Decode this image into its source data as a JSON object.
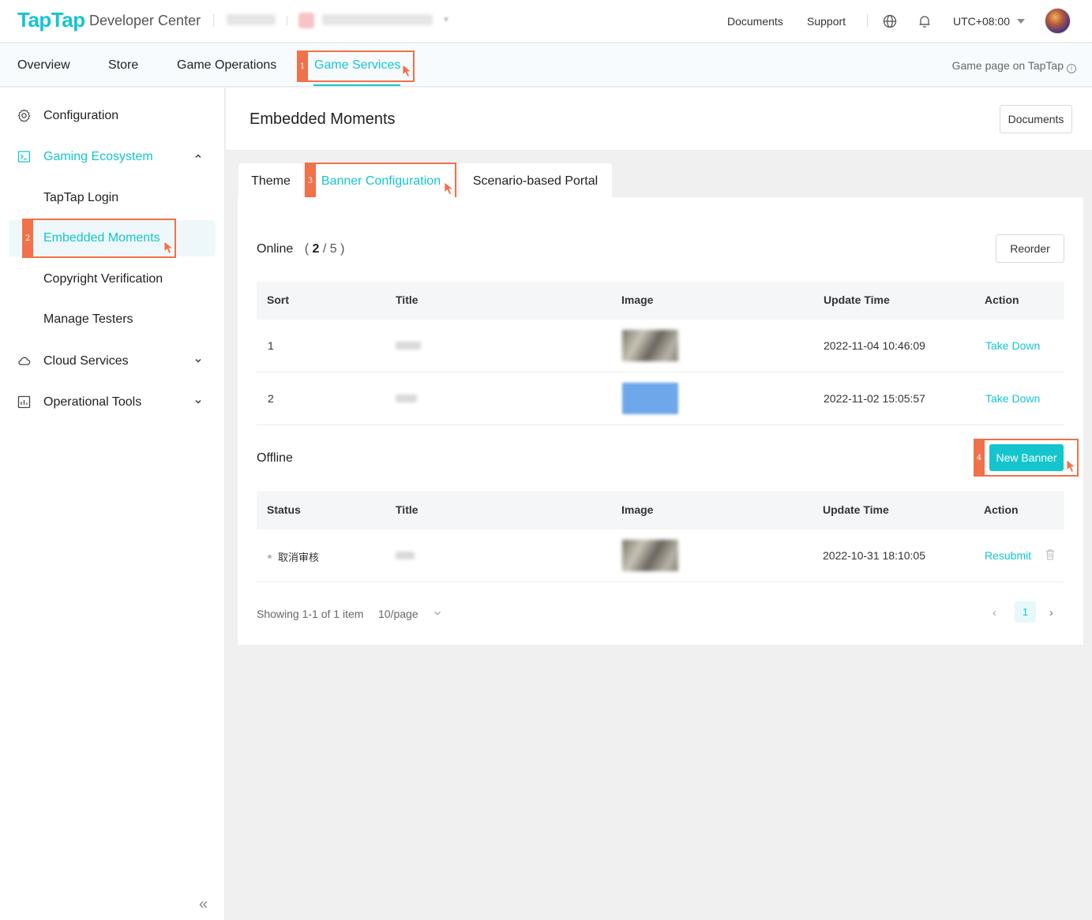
{
  "header": {
    "logo": "TapTap",
    "brand_subtitle": "Developer Center",
    "links": {
      "documents": "Documents",
      "support": "Support"
    },
    "timezone": "UTC+08:00",
    "icons": [
      "globe-icon",
      "bell-icon",
      "caret-down-icon",
      "avatar"
    ]
  },
  "nav": {
    "tabs": [
      {
        "label": "Overview"
      },
      {
        "label": "Store"
      },
      {
        "label": "Game Operations"
      },
      {
        "label": "Game Services",
        "active": true
      }
    ],
    "game_page_link": "Game page on TapTap"
  },
  "sidebar": {
    "items": [
      {
        "label": "Configuration",
        "icon": "gear-icon"
      },
      {
        "label": "Gaming Ecosystem",
        "icon": "terminal-icon",
        "expanded": true,
        "children": [
          {
            "label": "TapTap Login"
          },
          {
            "label": "Embedded Moments",
            "selected": true
          },
          {
            "label": "Copyright Verification"
          },
          {
            "label": "Manage Testers"
          }
        ]
      },
      {
        "label": "Cloud Services",
        "icon": "cloud-icon",
        "expanded": false
      },
      {
        "label": "Operational Tools",
        "icon": "chart-icon",
        "expanded": false
      }
    ],
    "collapse_glyph": "«"
  },
  "page": {
    "title": "Embedded Moments",
    "documents_button": "Documents",
    "tabs": [
      {
        "label": "Theme"
      },
      {
        "label": "Banner Configuration",
        "active": true
      },
      {
        "label": "Scenario-based Portal"
      }
    ]
  },
  "online": {
    "title": "Online",
    "count_open": "(",
    "count_current": "2",
    "count_sep": "/",
    "count_max": "5",
    "count_close": ")",
    "reorder_button": "Reorder",
    "columns": [
      "Sort",
      "Title",
      "Image",
      "Update Time",
      "Action"
    ],
    "rows": [
      {
        "sort": "1",
        "title": "test2",
        "image": "photo",
        "update_time": "2022-11-04 10:46:09",
        "action": "Take Down"
      },
      {
        "sort": "2",
        "title": "测试",
        "image": "blue",
        "update_time": "2022-11-02 15:05:57",
        "action": "Take Down"
      }
    ]
  },
  "offline": {
    "title": "Offline",
    "new_button": "New Banner",
    "columns": [
      "Status",
      "Title",
      "Image",
      "Update Time",
      "Action"
    ],
    "rows": [
      {
        "status": "取消审核",
        "title": "test",
        "image": "photo",
        "update_time": "2022-10-31 18:10:05",
        "action": "Resubmit"
      }
    ]
  },
  "pagination": {
    "summary": "Showing 1-1 of 1 item",
    "page_size": "10/page",
    "prev": "‹",
    "current_page": "1",
    "next": "›"
  },
  "annotations": [
    "1",
    "2",
    "3",
    "4"
  ],
  "colors": {
    "accent": "#15c5ce",
    "annotation": "#f0714a"
  }
}
